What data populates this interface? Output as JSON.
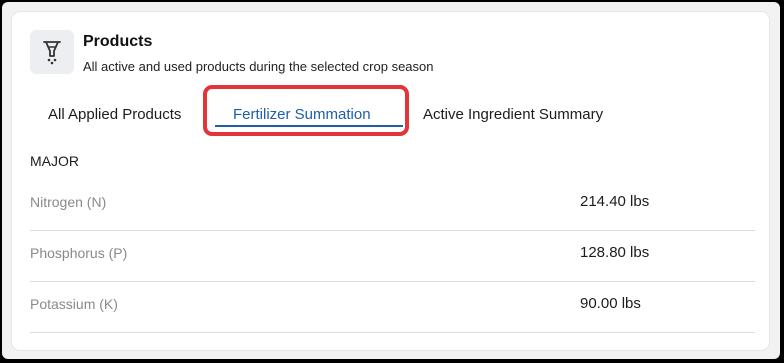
{
  "header": {
    "icon": "funnel-flask-icon",
    "title": "Products",
    "subtitle": "All active and used products during the selected crop season"
  },
  "tabs": [
    {
      "label": "All Applied Products",
      "active": false
    },
    {
      "label": "Fertilizer Summation",
      "active": true
    },
    {
      "label": "Active Ingredient Summary",
      "active": false
    }
  ],
  "section": {
    "label": "MAJOR"
  },
  "nutrients": [
    {
      "name": "Nitrogen (N)",
      "value": "214.40 lbs"
    },
    {
      "name": "Phosphorus (P)",
      "value": "128.80 lbs"
    },
    {
      "name": "Potassium (K)",
      "value": "90.00 lbs"
    }
  ],
  "colors": {
    "accent": "#1d5fa8",
    "highlight": "#e3343c"
  }
}
